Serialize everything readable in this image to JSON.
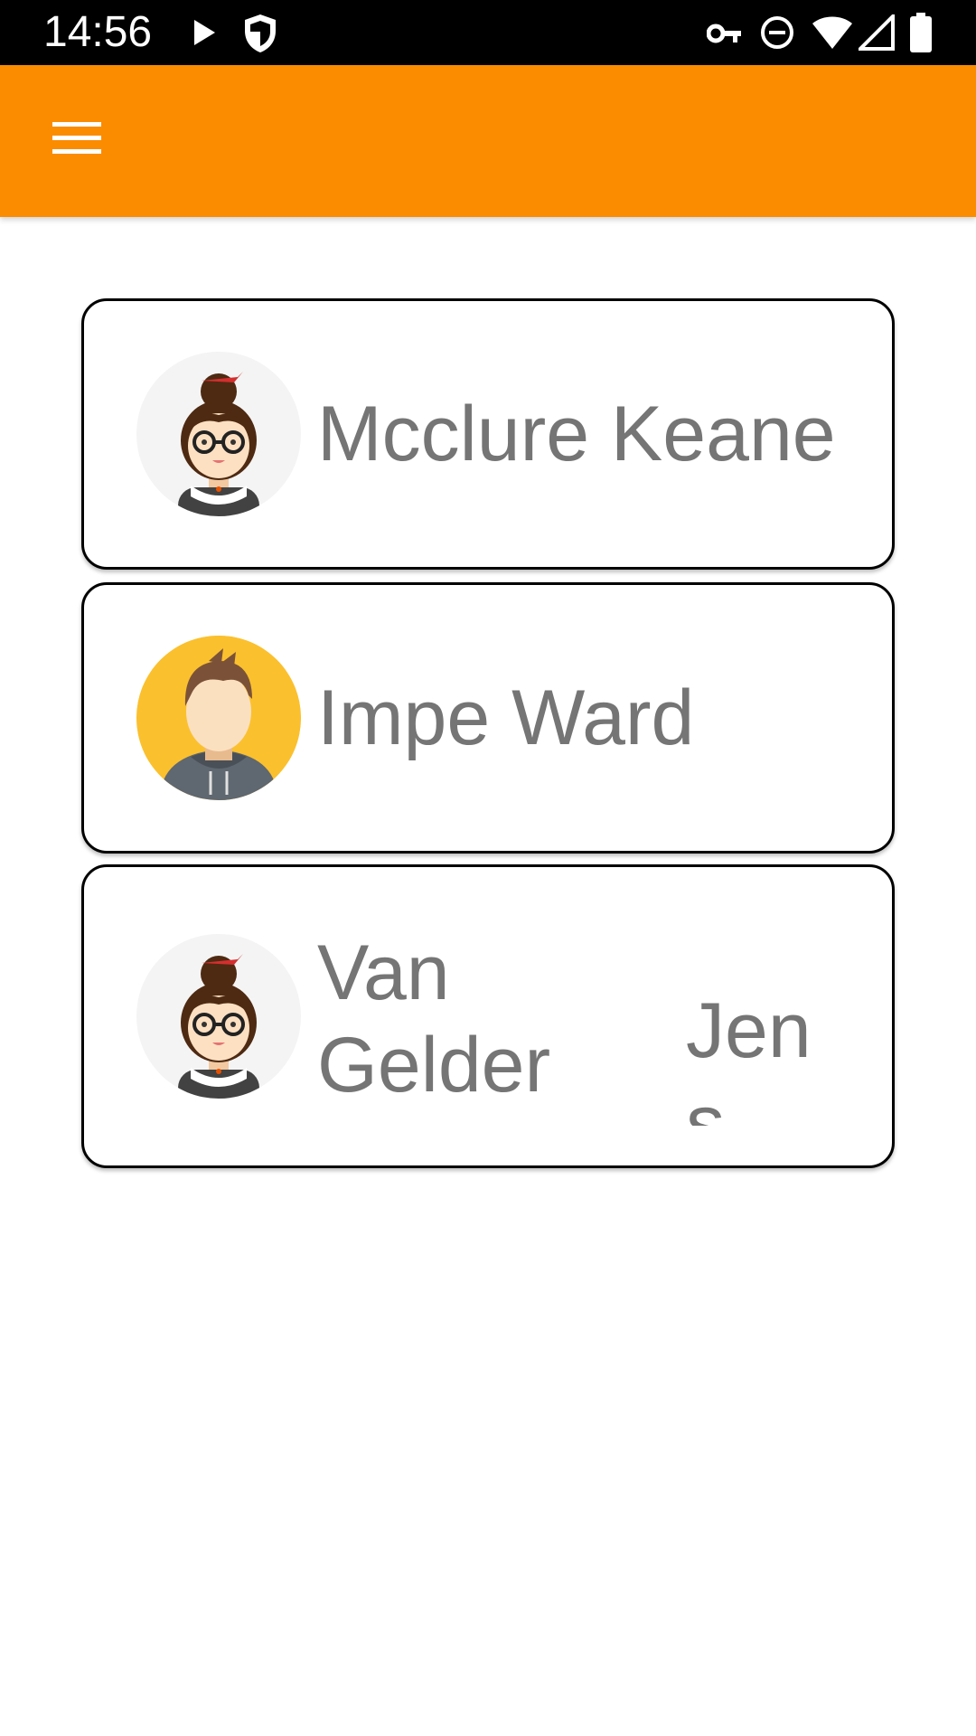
{
  "status_bar": {
    "time": "14:56",
    "left_icons": [
      "play-icon",
      "shield-icon"
    ],
    "right_icons": [
      "vpn-key-icon",
      "do-not-disturb-icon",
      "wifi-icon",
      "cell-signal-icon",
      "battery-icon"
    ]
  },
  "app_bar": {
    "color": "#FB8C00",
    "menu_icon": "hamburger-menu-icon"
  },
  "contacts": [
    {
      "first": "Mcclure",
      "last": "Keane",
      "full": "Mcclure Keane",
      "avatar": "female-glasses-avatar"
    },
    {
      "first": "Impe",
      "last": "Ward",
      "full": "Impe Ward",
      "avatar": "male-hoodie-avatar"
    },
    {
      "first": "Van\nGelder",
      "last": "Jens",
      "full": "Van Gelder Jens",
      "avatar": "female-glasses-avatar"
    }
  ],
  "colors": {
    "name_text": "#757575",
    "card_border": "#000000",
    "avatar_yellow_bg": "#FBC02D"
  }
}
